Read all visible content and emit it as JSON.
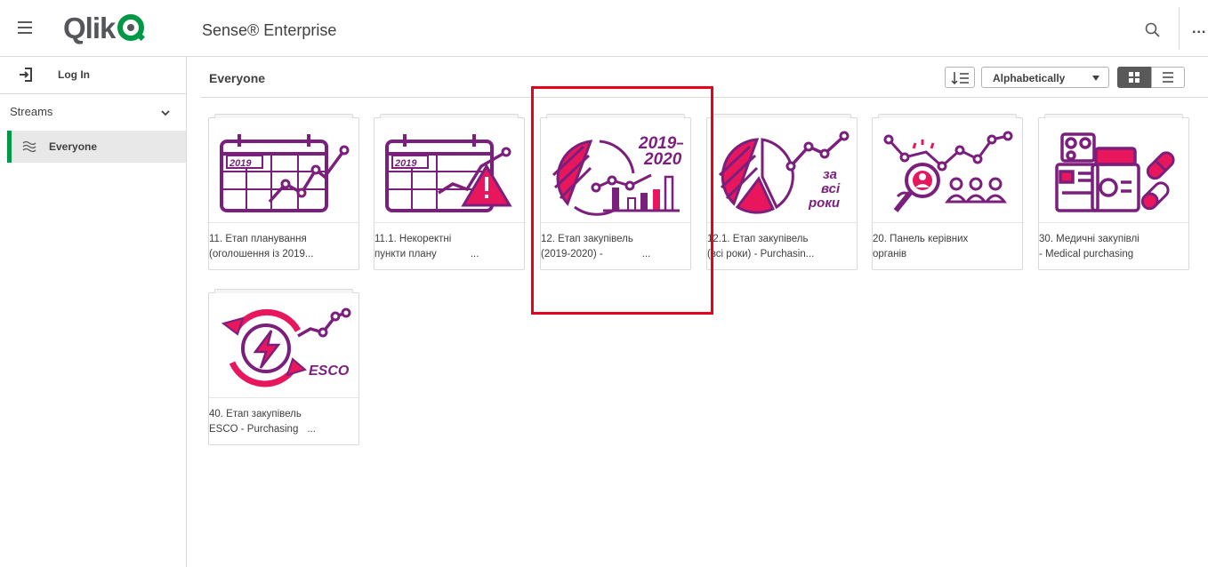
{
  "header": {
    "logo_text": "Qlik",
    "product_name": "Sense® Enterprise",
    "more_label": "..."
  },
  "sidebar": {
    "login_label": "Log In",
    "streams_label": "Streams",
    "stream_items": [
      {
        "label": "Everyone",
        "selected": true
      }
    ]
  },
  "toolbar": {
    "title": "Everyone",
    "sort_value": "Alphabetically"
  },
  "apps": [
    {
      "line1": "11. Етап планування",
      "line2": "(оголошення із 2019...",
      "thumb": "calendar-2019"
    },
    {
      "line1": "11.1. Некоректні",
      "line2": "пункти плану",
      "line2_suffix": "...",
      "thumb": "calendar-warning"
    },
    {
      "line1": "12. Етап закупівель",
      "line2": "(2019-2020) -",
      "line2_suffix": "...",
      "thumb": "pie-bars-2019-2020",
      "thumb_text1": "2019–",
      "thumb_text2": "2020"
    },
    {
      "line1": "12.1. Етап закупівель",
      "line2": "(всі роки) - Purchasin...",
      "thumb": "pie-all-years",
      "thumb_text1": "за",
      "thumb_text2": "всі",
      "thumb_text3": "роки"
    },
    {
      "line1": "20. Панель керівних",
      "line2": "органів",
      "thumb": "magnifier-people"
    },
    {
      "line1": "30. Медичні закупівлі",
      "line2": "- Medical purchasing",
      "thumb": "medical"
    },
    {
      "line1": "40. Етап закупівель",
      "line2": "ESCO - Purchasing",
      "line2_suffix": "...",
      "thumb": "energy-esco",
      "thumb_text1": "ESCO"
    }
  ],
  "colors": {
    "accent_green": "#009845",
    "thumb_purple": "#7b1f7d",
    "thumb_pink": "#e8175d",
    "highlight_red": "#e8001c"
  }
}
